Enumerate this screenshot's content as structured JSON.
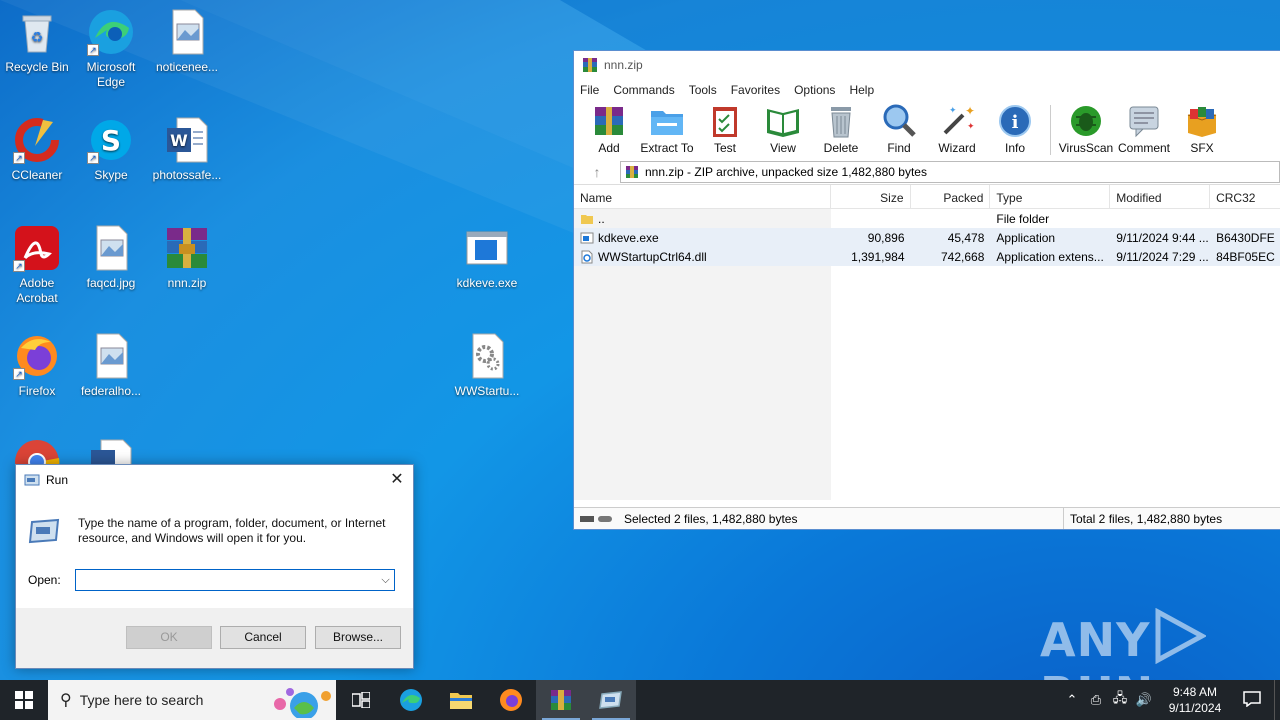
{
  "desktop": {
    "icons": [
      {
        "label": "Recycle Bin",
        "icon": "recycle-bin-icon"
      },
      {
        "label": "Microsoft Edge",
        "icon": "edge-icon"
      },
      {
        "label": "noticenee...",
        "icon": "image-file-icon"
      },
      {
        "label": "CCleaner",
        "icon": "ccleaner-icon"
      },
      {
        "label": "Skype",
        "icon": "skype-icon"
      },
      {
        "label": "photossafe...",
        "icon": "word-doc-icon"
      },
      {
        "label": "Adobe Acrobat",
        "icon": "acrobat-icon"
      },
      {
        "label": "faqcd.jpg",
        "icon": "image-file-icon"
      },
      {
        "label": "nnn.zip",
        "icon": "winrar-archive-icon"
      },
      {
        "label": "kdkeve.exe",
        "icon": "exe-file-icon"
      },
      {
        "label": "Firefox",
        "icon": "firefox-icon"
      },
      {
        "label": "federalho...",
        "icon": "image-file-icon"
      },
      {
        "label": "WWStartu...",
        "icon": "dll-file-icon"
      }
    ]
  },
  "winrar": {
    "title": "nnn.zip",
    "menu": [
      "File",
      "Commands",
      "Tools",
      "Favorites",
      "Options",
      "Help"
    ],
    "toolbar": [
      "Add",
      "Extract To",
      "Test",
      "View",
      "Delete",
      "Find",
      "Wizard",
      "Info",
      "VirusScan",
      "Comment",
      "SFX"
    ],
    "path": "nnn.zip - ZIP archive, unpacked size 1,482,880 bytes",
    "columns": [
      "Name",
      "Size",
      "Packed",
      "Type",
      "Modified",
      "CRC32"
    ],
    "rows": [
      {
        "name": "..",
        "size": "",
        "packed": "",
        "type": "File folder",
        "modified": "",
        "crc": ""
      },
      {
        "name": "kdkeve.exe",
        "size": "90,896",
        "packed": "45,478",
        "type": "Application",
        "modified": "9/11/2024 9:44 ...",
        "crc": "B6430DFE"
      },
      {
        "name": "WWStartupCtrl64.dll",
        "size": "1,391,984",
        "packed": "742,668",
        "type": "Application extens...",
        "modified": "9/11/2024 7:29 ...",
        "crc": "84BF05EC"
      }
    ],
    "status_left": "Selected 2 files, 1,482,880 bytes",
    "status_right": "Total 2 files, 1,482,880 bytes"
  },
  "run": {
    "title": "Run",
    "description": "Type the name of a program, folder, document, or Internet resource, and Windows will open it for you.",
    "open_label": "Open:",
    "open_value": "",
    "ok": "OK",
    "cancel": "Cancel",
    "browse": "Browse..."
  },
  "taskbar": {
    "search_placeholder": "Type here to search",
    "time": "9:48 AM",
    "date": "9/11/2024"
  },
  "watermark": "ANY RUN"
}
